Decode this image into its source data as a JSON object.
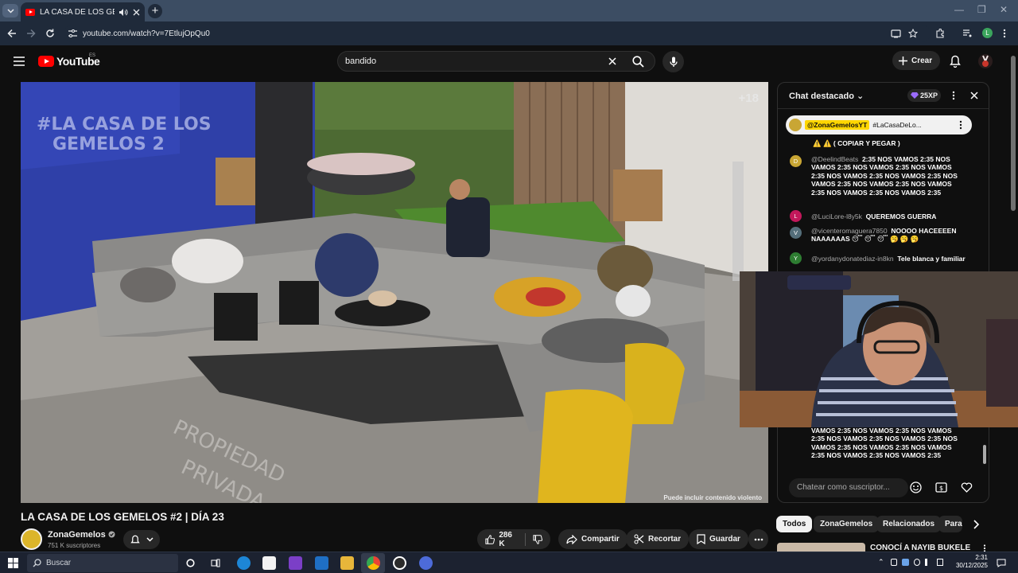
{
  "browser": {
    "tab_title": "LA CASA DE LOS GEMELOS",
    "url": "youtube.com/watch?v=7EtlujOpQu0",
    "profile_initial": "L"
  },
  "header": {
    "logo_text": "YouTube",
    "country_code": "ES",
    "search_value": "bandido",
    "create_label": "Crear"
  },
  "video": {
    "rating_badge": "+18",
    "disclaimer": "Puede incluir contenido violento",
    "title": "LA CASA DE LOS GEMELOS #2 | DÍA 23",
    "channel": "ZonaGemelos",
    "subscribers": "751 K suscriptores",
    "likes": "286 K",
    "share_label": "Compartir",
    "clip_label": "Recortar",
    "save_label": "Guardar"
  },
  "chat": {
    "header_title": "Chat destacado",
    "xp_label": "25XP",
    "pinned_author": "@ZonaGemelosYT",
    "pinned_text": "#LaCasaDeLo...",
    "top_line": "( COPIAR Y PEGAR )",
    "messages": [
      {
        "avatar": "D",
        "author": "@DeelindBeats",
        "text": "2:35 NOS VAMOS 2:35 NOS VAMOS 2:35 NOS VAMOS 2:35 NOS VAMOS 2:35 NOS VAMOS 2:35 NOS VAMOS 2:35 NOS VAMOS 2:35 NOS VAMOS 2:35 NOS VAMOS 2:35 NOS VAMOS 2:35 NOS VAMOS 2:35"
      },
      {
        "avatar": "L",
        "author": "@LuciLore-l8y5k",
        "text": "QUEREMOS GUERRA"
      },
      {
        "avatar": "V",
        "author": "@vicenteromaguera7850",
        "text": "NOOOO HACEEEEN NAAAAAAS 😴 😴 😴 🥱 🥱 🥱"
      },
      {
        "avatar": "Y",
        "author": "@yordanydonatediaz-in8kn",
        "text": "Tele blanca y familiar"
      }
    ],
    "bottom_message": "VAMOS 2:35 NOS VAMOS 2:35 NOS VAMOS 2:35 NOS VAMOS 2:35 NOS VAMOS 2:35 NOS VAMOS 2:35 NOS VAMOS 2:35 NOS VAMOS 2:35 NOS VAMOS 2:35 NOS VAMOS 2:35",
    "input_placeholder": "Chatear como suscriptor..."
  },
  "chips": [
    "Todos",
    "ZonaGemelos",
    "Relacionados",
    "Para"
  ],
  "recommendation_title": "CONOCÍ A NAYIB BUKELE",
  "taskbar": {
    "search_label": "Buscar",
    "time": "2:31",
    "date": "30/12/2025"
  },
  "colors": {
    "accent": "#ff0000",
    "pinned_chip": "#ffd600"
  }
}
